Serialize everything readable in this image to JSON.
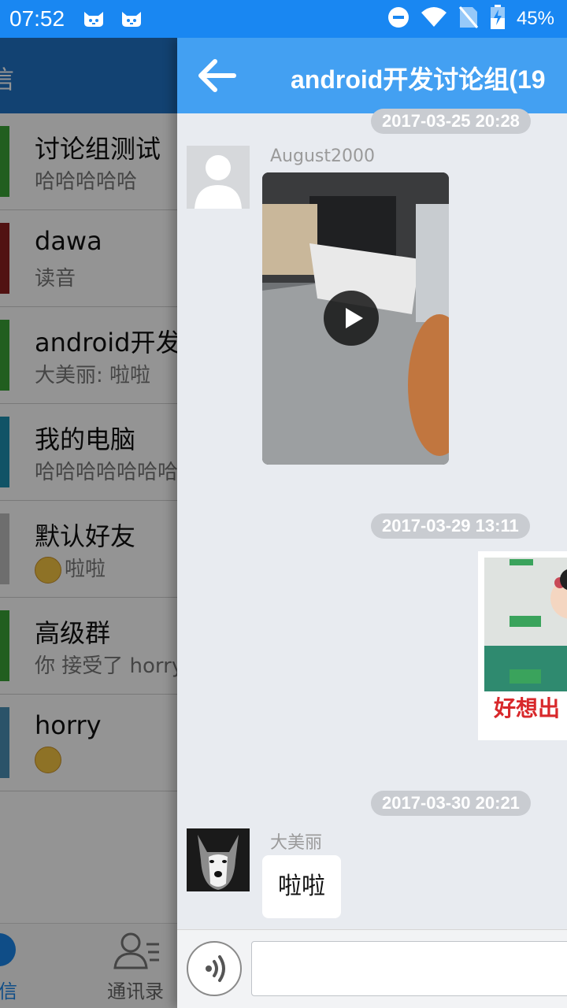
{
  "status_bar": {
    "time": "07:52",
    "battery_pct": "45%",
    "icons": [
      "cat-face-icon",
      "cat-face-icon",
      "do-not-disturb-icon",
      "wifi-icon",
      "no-sim-icon",
      "battery-charging-icon"
    ]
  },
  "background_list": {
    "header_title": "信",
    "conversations": [
      {
        "name": "讨论组测试",
        "preview": "哈哈哈哈哈",
        "avatar_color": "#3aa336"
      },
      {
        "name": "dawa",
        "preview": "读音",
        "avatar_color": "#8c1f1f"
      },
      {
        "name": "android开发讨",
        "preview": "大美丽: 啦啦",
        "avatar_color": "#3aa336"
      },
      {
        "name": "我的电脑",
        "preview": "哈哈哈哈哈哈哈",
        "avatar_color": "#1e8fb0"
      },
      {
        "name": "默认好友",
        "preview": "啦啦",
        "avatar_color": "#bdbdbd",
        "preview_emoji": "smiley-icon"
      },
      {
        "name": "高级群",
        "preview": "你 接受了 horry",
        "avatar_color": "#3aa336"
      },
      {
        "name": "horry",
        "preview": "",
        "avatar_color": "#4a8fb6",
        "preview_emoji": "smirk-icon"
      }
    ],
    "tabs": {
      "messages_label": "信",
      "contacts_label": "通讯录"
    }
  },
  "chat": {
    "title": "android开发讨论组(19",
    "messages": [
      {
        "timestamp": "2017-03-25 20:28"
      },
      {
        "sender": "August2000",
        "type": "video"
      },
      {
        "timestamp": "2017-03-29 13:11"
      },
      {
        "type": "sticker",
        "text": "好想出"
      },
      {
        "timestamp": "2017-03-30 20:21"
      },
      {
        "sender": "大美丽",
        "type": "text",
        "text": "啦啦"
      }
    ],
    "input": {
      "value": "",
      "placeholder": ""
    }
  },
  "colors": {
    "status_bar": "#1987f2",
    "chat_header": "#43a0f2",
    "chat_background": "#e8ebf0",
    "timestamp_pill": "#c9ccd1",
    "accent": "#1a86e8"
  }
}
